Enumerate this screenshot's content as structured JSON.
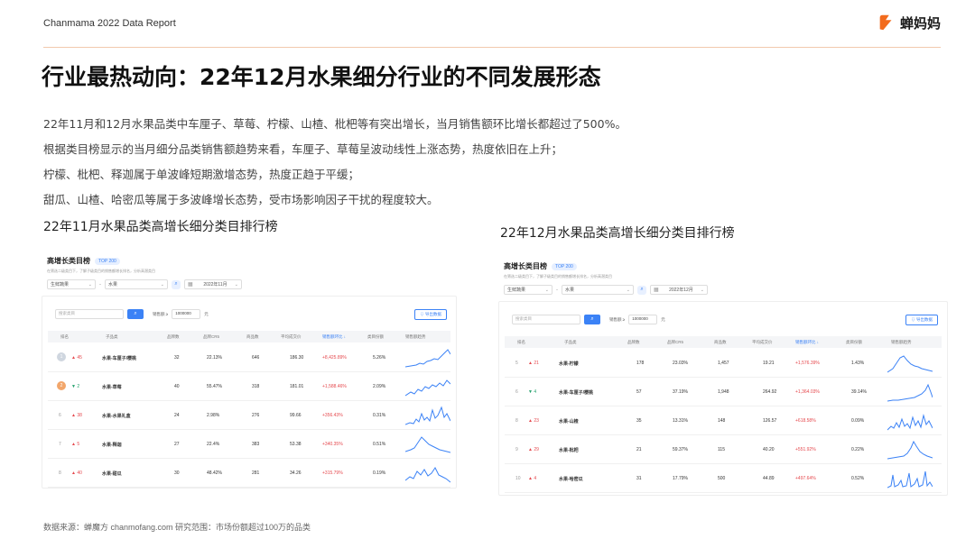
{
  "header": {
    "report_label": "Chanmama 2022 Data Report",
    "brand_name": "蝉妈妈",
    "accent_color": "#f26b1d"
  },
  "title": "行业最热动向：22年12月水果细分行业的不同发展形态",
  "paragraphs": [
    "22年11月和12月水果品类中车厘子、草莓、柠檬、山楂、枇杷等有突出增长，当月销售额环比增长都超过了500%。",
    "根据类目榜显示的当月细分品类销售额趋势来看，车厘子、草莓呈波动线性上涨态势，热度依旧在上升；",
    "柠檬、枇杷、释迦属于单波峰短期激增态势，热度正趋于平缓；",
    "甜瓜、山楂、哈密瓜等属于多波峰增长态势，受市场影响因子干扰的程度较大。"
  ],
  "section1_title": "22年11月水果品类高增长细分类目排行榜",
  "section2_title": "22年12月水果品类高增长细分类目排行榜",
  "panel_common": {
    "title": "高增长类目榜",
    "badge": "TOP 200",
    "subtitle": "在筛选二级类目下，了解子级类目的销售额增长排名，分析高潜类目",
    "filter_1": "生鲜蔬果",
    "filter_2": "水果",
    "search_placeholder": "搜索类目",
    "sales_label": "销售额 ≥",
    "sales_value": "1000000",
    "sales_unit": "元",
    "export_label": "导出数据",
    "headers": [
      "排名",
      "子品类",
      "品牌数",
      "品牌CR5",
      "商品数",
      "平均成交价",
      "销售额环比 ↓",
      "类目份额",
      "销售额趋势"
    ]
  },
  "panel1": {
    "date": "2022年11月",
    "rows": [
      {
        "rank": "1",
        "change": "▲ 45",
        "name": "水果-车厘子/樱桃",
        "brands": "32",
        "cr5": "22.13%",
        "products": "646",
        "price": "186.30",
        "growth": "+8,425.89%",
        "share": "5.26%"
      },
      {
        "rank": "2",
        "change": "▼ 2",
        "name": "水果-草莓",
        "brands": "40",
        "cr5": "55.47%",
        "products": "318",
        "price": "181.01",
        "growth": "+1,588.46%",
        "share": "2.09%"
      },
      {
        "rank": "6",
        "change": "▲ 38",
        "name": "水果-水果礼盒",
        "brands": "24",
        "cr5": "2.98%",
        "products": "276",
        "price": "99.66",
        "growth": "+356.43%",
        "share": "0.31%"
      },
      {
        "rank": "7",
        "change": "▲ 5",
        "name": "水果-释迦",
        "brands": "27",
        "cr5": "22.4%",
        "products": "383",
        "price": "53.38",
        "growth": "+340.35%",
        "share": "0.51%"
      },
      {
        "rank": "8",
        "change": "▲ 40",
        "name": "水果-甜瓜",
        "brands": "30",
        "cr5": "48.42%",
        "products": "281",
        "price": "34.26",
        "growth": "+315.79%",
        "share": "0.19%"
      }
    ]
  },
  "panel2": {
    "date": "2022年12月",
    "rows": [
      {
        "rank": "5",
        "change": "▲ 21",
        "name": "水果-柠檬",
        "brands": "178",
        "cr5": "23.03%",
        "products": "1,457",
        "price": "19.21",
        "growth": "+1,576.39%",
        "share": "1.43%"
      },
      {
        "rank": "6",
        "change": "▼ 4",
        "name": "水果-车厘子/樱桃",
        "brands": "57",
        "cr5": "37.19%",
        "products": "1,948",
        "price": "264.92",
        "growth": "+1,364.03%",
        "share": "39.14%"
      },
      {
        "rank": "8",
        "change": "▲ 23",
        "name": "水果-山楂",
        "brands": "35",
        "cr5": "13.31%",
        "products": "148",
        "price": "126.57",
        "growth": "+618.58%",
        "share": "0.09%"
      },
      {
        "rank": "9",
        "change": "▲ 29",
        "name": "水果-枇杷",
        "brands": "21",
        "cr5": "59.37%",
        "products": "115",
        "price": "40.20",
        "growth": "+551.92%",
        "share": "0.22%"
      },
      {
        "rank": "10",
        "change": "▲ 4",
        "name": "水果-哈密瓜",
        "brands": "31",
        "cr5": "17.79%",
        "products": "500",
        "price": "44.89",
        "growth": "+497.64%",
        "share": "0.52%"
      }
    ]
  },
  "footer": "数据来源：蝉魔方 chanmofang.com   研究范围：市场份额超过100万的品类"
}
